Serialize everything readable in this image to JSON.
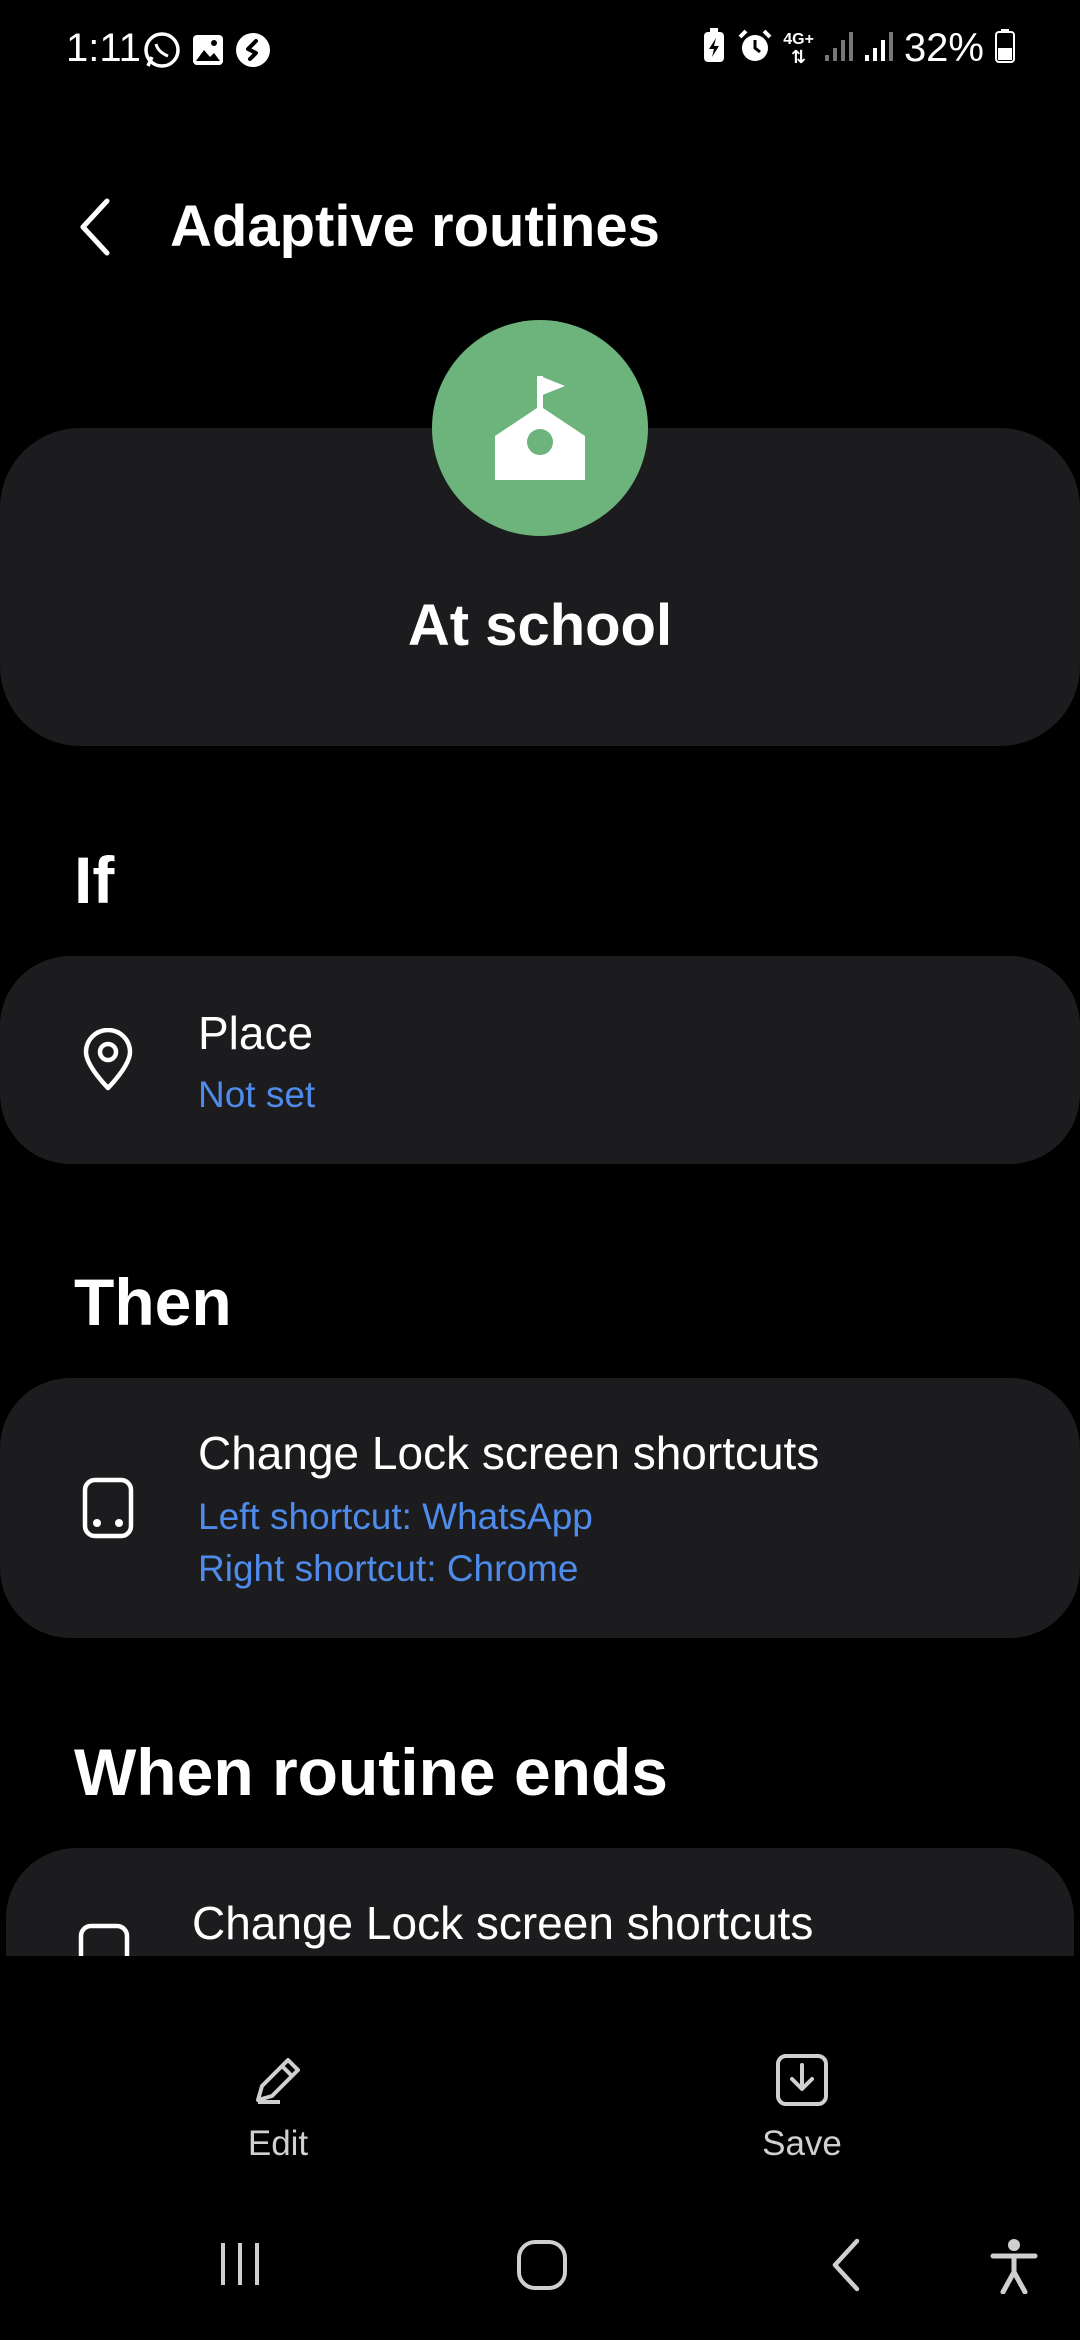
{
  "status_bar": {
    "time": "1:11",
    "left_icons": [
      "whatsapp-icon",
      "gallery-icon",
      "shazam-icon"
    ],
    "right_icons": [
      "battery-saver-icon",
      "alarm-icon",
      "network-4g-icon",
      "signal-1-icon",
      "signal-2-icon"
    ],
    "network_label": "4G+",
    "battery_percent": "32%"
  },
  "header": {
    "title": "Adaptive routines"
  },
  "routine": {
    "name": "At school",
    "icon": "school-icon",
    "icon_color": "#6cb37c"
  },
  "sections": {
    "if": {
      "heading": "If",
      "item": {
        "icon": "location-pin-icon",
        "title": "Place",
        "subtitle": "Not set"
      }
    },
    "then": {
      "heading": "Then",
      "item": {
        "icon": "phone-shortcuts-icon",
        "title": "Change Lock screen shortcuts",
        "line1": "Left shortcut: WhatsApp",
        "line2": "Right shortcut: Chrome"
      }
    },
    "ends": {
      "heading": "When routine ends",
      "item": {
        "icon": "phone-shortcuts-icon",
        "title": "Change Lock screen shortcuts"
      }
    }
  },
  "actions": {
    "edit_label": "Edit",
    "save_label": "Save"
  },
  "nav_bar": {
    "items": [
      "recent-apps-icon",
      "home-icon",
      "back-icon",
      "accessibility-icon"
    ]
  },
  "colors": {
    "background": "#000000",
    "card": "#1c1c1e",
    "accent_link": "#4e8bea",
    "routine_green": "#6cb37c"
  }
}
